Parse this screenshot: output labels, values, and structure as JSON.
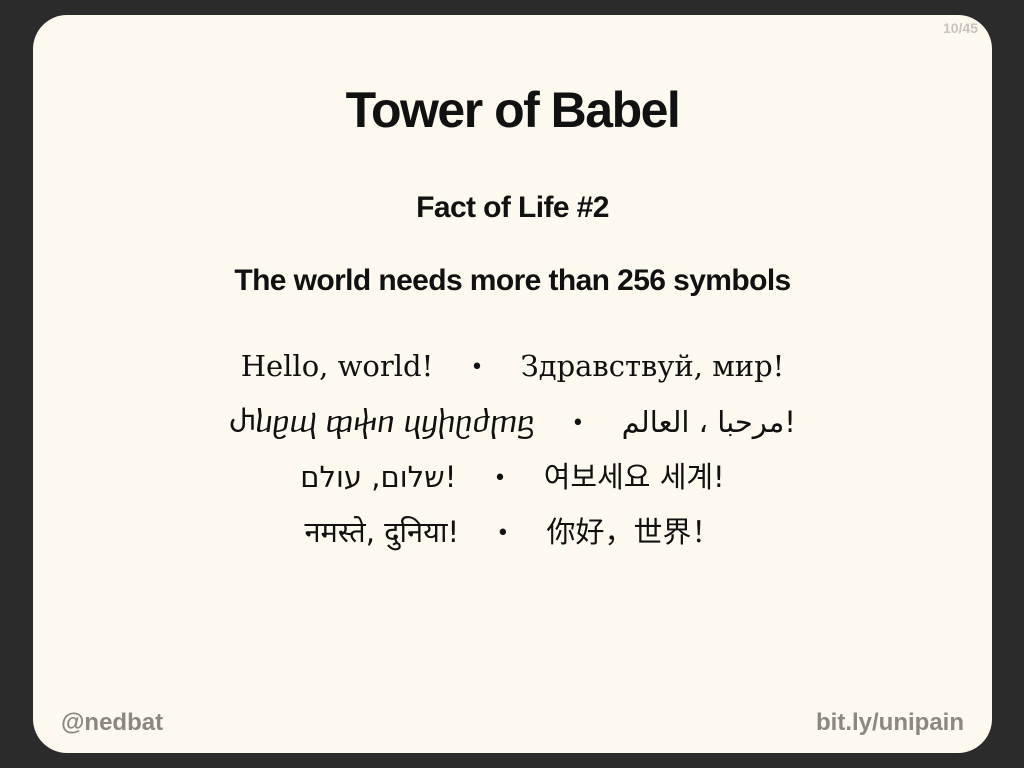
{
  "slide": {
    "page_counter": "10/45",
    "title": "Tower of Babel",
    "subtitle": "Fact of Life #2",
    "statement": "The world needs more than 256 symbols",
    "bullet": "•",
    "greetings": [
      {
        "left": "Hello, world!",
        "right": "Здравствуй, мир!"
      },
      {
        "left": "Ⴐⴑⴒⴓ ⴔⴕⴖ ⴗⴘⴙⴚⴛⴜⴝ",
        "right": "!مرحبا ، العالم"
      },
      {
        "left": "!שלום, עולם",
        "right": "여보세요 세계!"
      },
      {
        "left": "नमस्ते, दुनिया!",
        "right": "你好，世界！"
      }
    ],
    "footer_left": "@nedbat",
    "footer_right": "bit.ly/unipain"
  }
}
